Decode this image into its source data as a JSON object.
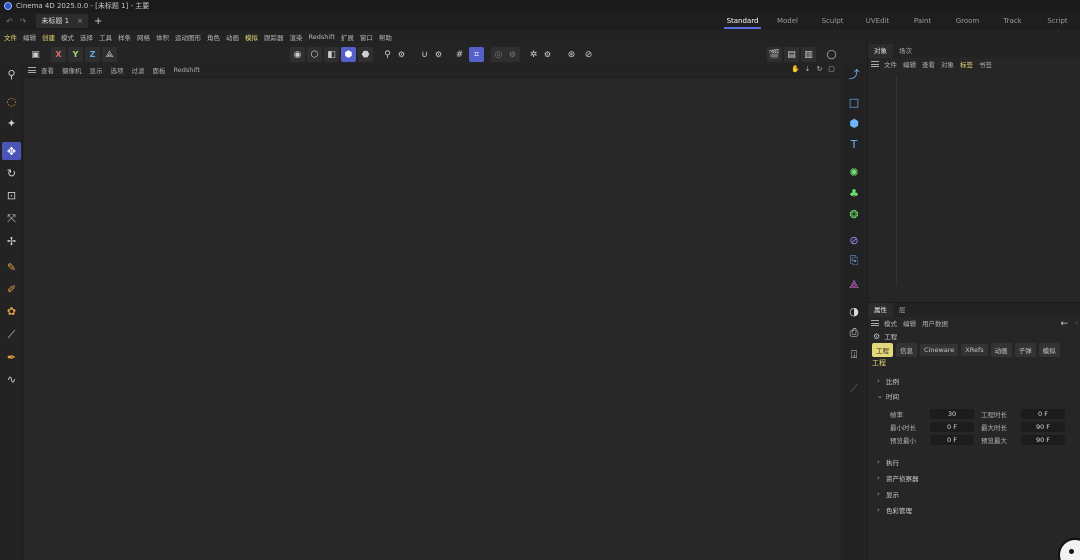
{
  "window": {
    "title": "Cinema 4D 2025.0.0 - [未标题 1] - 主要"
  },
  "tabs": {
    "document": "未标题 1",
    "close": "×",
    "add": "+",
    "undo": "↶",
    "redo": "↷"
  },
  "layouts": [
    "Standard",
    "Model",
    "Sculpt",
    "UVEdit",
    "Paint",
    "Groom",
    "Track",
    "Script"
  ],
  "menu": [
    "文件",
    "编辑",
    "创建",
    "模式",
    "选择",
    "工具",
    "样条",
    "网格",
    "体积",
    "运动图形",
    "角色",
    "动画",
    "模拟",
    "跟踪器",
    "渲染",
    "Redshift",
    "扩展",
    "窗口",
    "帮助"
  ],
  "axes": {
    "x": "X",
    "y": "Y",
    "z": "Z"
  },
  "viewport": {
    "menu": [
      "查看",
      "摄像机",
      "显示",
      "选项",
      "过滤",
      "面板",
      "Redshift"
    ]
  },
  "object_panel": {
    "tabs": [
      "对象",
      "场次"
    ],
    "menu": [
      "文件",
      "编辑",
      "查看",
      "对象",
      "标签",
      "书签"
    ]
  },
  "attr_panel": {
    "tabs": [
      "属性",
      "层"
    ],
    "menu": [
      "模式",
      "编辑",
      "用户数据"
    ],
    "title": "工程",
    "subtabs": [
      "工程",
      "信息",
      "Cineware",
      "XRefs",
      "动画",
      "子弹",
      "模拟"
    ],
    "section": "工程",
    "groups": {
      "scale": "比例",
      "time": "时间",
      "execute": "执行",
      "asset_inspector": "资产侦察器",
      "display": "显示",
      "color_management": "色彩管理"
    },
    "fields": {
      "fps_label": "帧率",
      "fps_value": "30",
      "project_time_label": "工程时长",
      "project_time_value": "0 F",
      "min_time_label": "最小时长",
      "min_time_value": "0 F",
      "max_time_label": "最大时长",
      "max_time_value": "90 F",
      "preview_min_label": "预览最小",
      "preview_min_value": "0 F",
      "preview_max_label": "预览最大",
      "preview_max_value": "90 F"
    }
  },
  "colors": {
    "accent": "#5560c8",
    "highlight": "#e6d978",
    "background": "#242424"
  }
}
